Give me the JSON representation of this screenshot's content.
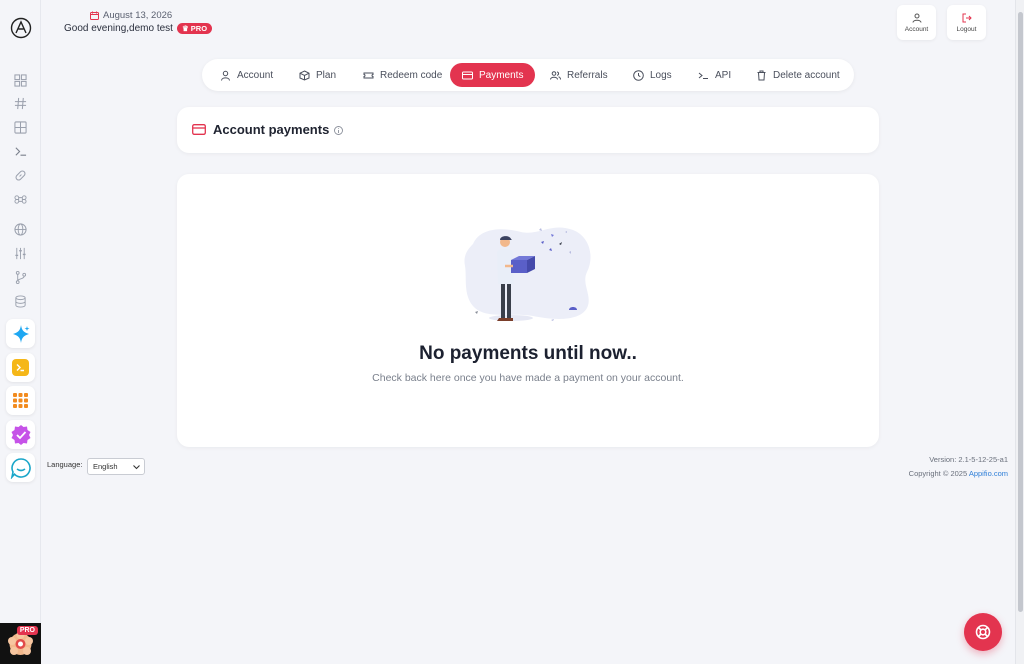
{
  "header": {
    "date": "August 13, 2026",
    "greeting": "Good evening,demo test",
    "badge": "PRO",
    "account_label": "Account",
    "logout_label": "Logout"
  },
  "sidebar": {
    "icons": [
      "dashboard-icon",
      "hash-icon",
      "grid-icon",
      "terminal-icon",
      "link-icon",
      "command-icon",
      "globe-icon",
      "sliders-icon",
      "git-branch-icon",
      "database-icon"
    ],
    "apps": [
      "sparkle-app",
      "console-app",
      "grid-app",
      "check-app",
      "chat-app"
    ],
    "avatar_badge": "PRO"
  },
  "tabs": [
    {
      "label": "Account",
      "icon": "user-icon"
    },
    {
      "label": "Plan",
      "icon": "box-icon"
    },
    {
      "label": "Redeem code",
      "icon": "ticket-icon"
    },
    {
      "label": "Payments",
      "icon": "credit-card-icon",
      "active": true
    },
    {
      "label": "Referrals",
      "icon": "users-icon"
    },
    {
      "label": "Logs",
      "icon": "clock-icon"
    },
    {
      "label": "API",
      "icon": "terminal-icon"
    },
    {
      "label": "Delete account",
      "icon": "trash-icon"
    }
  ],
  "payments": {
    "title": "Account payments",
    "empty_title": "No payments until now..",
    "empty_subtitle": "Check back here once you have made a payment on your account."
  },
  "footer": {
    "language_label": "Language:",
    "language_value": "English",
    "version": "Version: 2.1-5-12-25-a1",
    "copyright": "Copyright © 2025 ",
    "copyright_link": "Appifio.com"
  },
  "colors": {
    "accent": "#e3344f",
    "background": "#f4f5f9",
    "link": "#2f7fd8"
  }
}
